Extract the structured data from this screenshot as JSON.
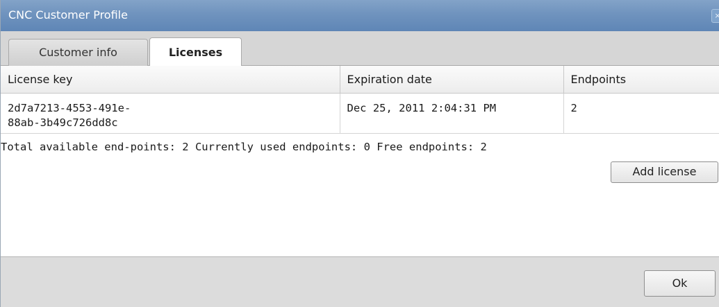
{
  "window": {
    "title": "CNC Customer Profile",
    "close_glyph": "×"
  },
  "tabs": [
    {
      "label": "Customer info",
      "selected": false
    },
    {
      "label": "Licenses",
      "selected": true
    }
  ],
  "licenses_table": {
    "columns": [
      "License key",
      "Expiration date",
      "Endpoints"
    ],
    "rows": [
      {
        "license_key_line1": "2d7a7213-4553-491e-",
        "license_key_line2": "88ab-3b49c726dd8c",
        "expiration_date": "Dec 25, 2011 2:04:31 PM",
        "endpoints": "2"
      }
    ]
  },
  "summary": "Total available end-points: 2 Currently used endpoints: 0 Free endpoints: 2",
  "buttons": {
    "add_license": "Add license",
    "ok": "Ok"
  },
  "colors": {
    "titlebar": "#6f93be",
    "tabstrip": "#d6d6d6",
    "footer": "#dcdcdc"
  },
  "icons": {
    "close": "close-icon"
  }
}
